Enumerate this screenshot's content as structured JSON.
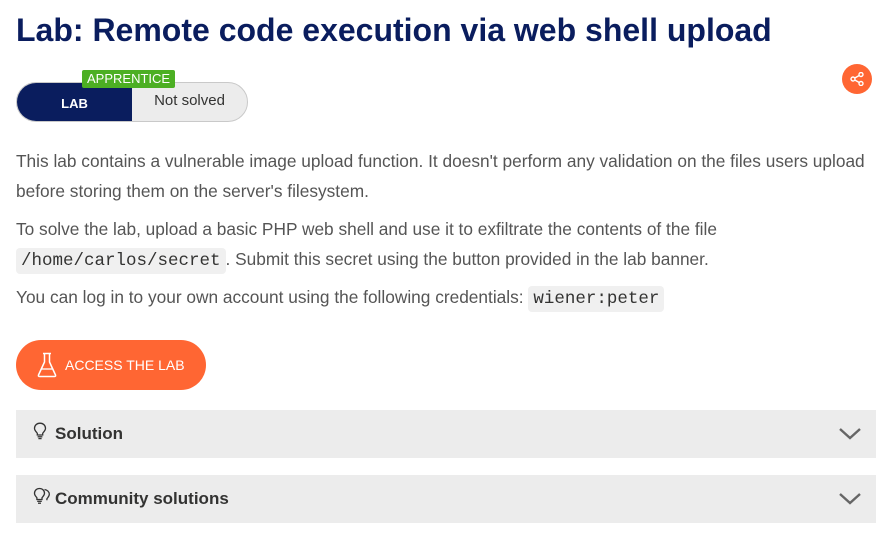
{
  "title": "Lab: Remote code execution via web shell upload",
  "share": {
    "icon": "share-icon"
  },
  "status": {
    "lab_label": "LAB",
    "level_badge": "APPRENTICE",
    "state": "Not solved"
  },
  "description": {
    "p1": "This lab contains a vulnerable image upload function. It doesn't perform any validation on the files users upload before storing them on the server's filesystem.",
    "p2_before": "To solve the lab, upload a basic PHP web shell and use it to exfiltrate the contents of the file ",
    "p2_code": "/home/carlos/secret",
    "p2_after": ". Submit this secret using the button provided in the lab banner.",
    "p3_before": "You can log in to your own account using the following credentials: ",
    "p3_code": "wiener:peter"
  },
  "access_button": {
    "label": "ACCESS THE LAB",
    "icon": "flask-icon"
  },
  "accordions": [
    {
      "label": "Solution",
      "icon": "lightbulb-icon"
    },
    {
      "label": "Community solutions",
      "icon": "lightbulbs-icon"
    }
  ],
  "colors": {
    "title": "#0a1d5e",
    "accent": "#ff6633",
    "badge": "#4caf23",
    "panel": "#ececec"
  }
}
